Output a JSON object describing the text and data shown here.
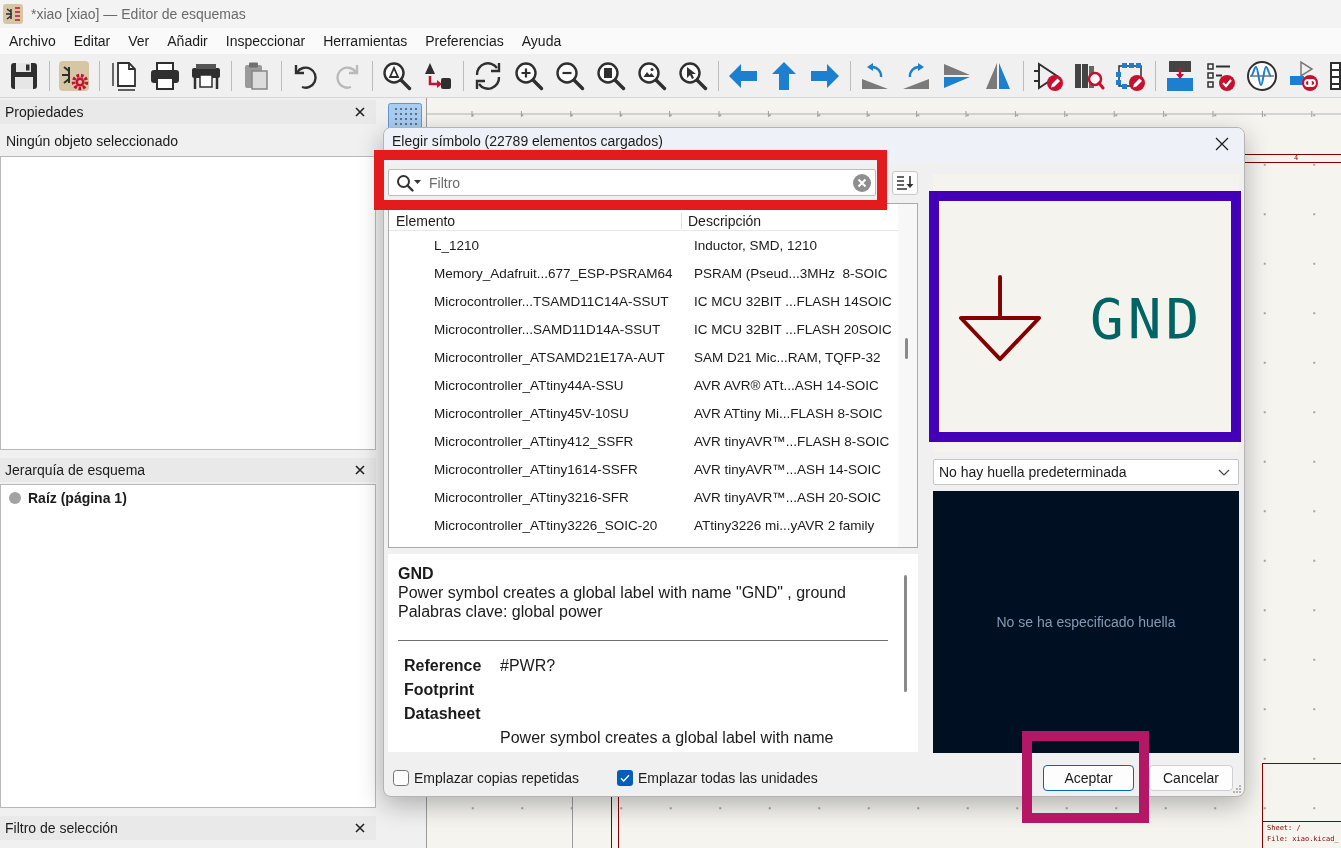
{
  "window": {
    "title": "*xiao [xiao] — Editor de esquemas"
  },
  "menu": [
    "Archivo",
    "Editar",
    "Ver",
    "Añadir",
    "Inspeccionar",
    "Herramientas",
    "Preferencias",
    "Ayuda"
  ],
  "toolbar": {
    "groups": [
      [
        {
          "kind": "save",
          "disabled": false
        }
      ],
      [
        {
          "kind": "schematic-setup",
          "disabled": false
        }
      ],
      [
        {
          "kind": "page-settings",
          "disabled": false
        },
        {
          "kind": "print",
          "disabled": false
        },
        {
          "kind": "plot",
          "disabled": false
        }
      ],
      [
        {
          "kind": "paste",
          "disabled": false
        }
      ],
      [
        {
          "kind": "undo",
          "disabled": false
        },
        {
          "kind": "redo",
          "disabled": true
        }
      ],
      [
        {
          "kind": "find",
          "disabled": false
        },
        {
          "kind": "find-replace",
          "disabled": false
        }
      ],
      [
        {
          "kind": "refresh",
          "disabled": false
        },
        {
          "kind": "zoom-in",
          "disabled": false
        },
        {
          "kind": "zoom-out",
          "disabled": false
        },
        {
          "kind": "zoom-fit",
          "disabled": false
        },
        {
          "kind": "zoom-objects",
          "disabled": false
        },
        {
          "kind": "zoom-selection",
          "disabled": false
        }
      ],
      [
        {
          "kind": "pan-left",
          "disabled": false
        },
        {
          "kind": "pan-up",
          "disabled": false
        },
        {
          "kind": "pan-right",
          "disabled": false
        }
      ],
      [
        {
          "kind": "rotate-ccw",
          "disabled": false
        },
        {
          "kind": "rotate-cw",
          "disabled": false
        },
        {
          "kind": "mirror-v",
          "disabled": false
        },
        {
          "kind": "mirror-h",
          "disabled": false
        }
      ],
      [
        {
          "kind": "symbol-fields",
          "disabled": false
        },
        {
          "kind": "library-browser",
          "disabled": false
        },
        {
          "kind": "edit-symbol",
          "disabled": false
        }
      ],
      [
        {
          "kind": "annotate",
          "disabled": false
        },
        {
          "kind": "erc",
          "disabled": false
        },
        {
          "kind": "simulator",
          "disabled": false
        },
        {
          "kind": "assign-footprints",
          "disabled": false
        },
        {
          "kind": "table",
          "disabled": false
        }
      ]
    ]
  },
  "properties_panel": {
    "title": "Propiedades",
    "message": "Ningún objeto seleccionado"
  },
  "hierarchy_panel": {
    "title": "Jerarquía de esquema",
    "items": [
      {
        "label": "Raíz (página 1)",
        "current": true
      }
    ]
  },
  "selection_filter_panel": {
    "title": "Filtro de selección"
  },
  "canvas": {
    "toolbar": [
      {
        "kind": "grid",
        "on": true
      }
    ],
    "frame_column_label": "4",
    "title_block": {
      "sheet": "Sheet: /",
      "file": "File: xiao.kicad_"
    }
  },
  "dialog": {
    "title": "Elegir símbolo (22789 elementos cargados)",
    "search": {
      "placeholder": "Filtro"
    },
    "columns": [
      "Elemento",
      "Descripción"
    ],
    "rows": [
      {
        "name": "L_1210",
        "description": "Inductor, SMD, 1210",
        "selected": false
      },
      {
        "name": "Memory_Adafruit...677_ESP-PSRAM64",
        "description": "PSRAM (Pseud...3MHz  8-SOIC",
        "selected": false
      },
      {
        "name": "Microcontroller...TSAMD11C14A-SSUT",
        "description": "IC MCU 32BIT ...FLASH 14SOIC",
        "selected": false
      },
      {
        "name": "Microcontroller...SAMD11D14A-SSUT",
        "description": "IC MCU 32BIT ...FLASH 20SOIC",
        "selected": false
      },
      {
        "name": "Microcontroller_ATSAMD21E17A-AUT",
        "description": "SAM D21 Mic...RAM, TQFP-32",
        "selected": false
      },
      {
        "name": "Microcontroller_ATtiny44A-SSU",
        "description": "AVR AVR® ATt...ASH 14-SOIC",
        "selected": false
      },
      {
        "name": "Microcontroller_ATtiny45V-10SU",
        "description": "AVR ATtiny Mi...FLASH 8-SOIC",
        "selected": false
      },
      {
        "name": "Microcontroller_ATtiny412_SSFR",
        "description": "AVR tinyAVR™...FLASH 8-SOIC",
        "selected": false
      },
      {
        "name": "Microcontroller_ATtiny1614-SSFR",
        "description": "AVR tinyAVR™...ASH 14-SOIC",
        "selected": false
      },
      {
        "name": "Microcontroller_ATtiny3216-SFR",
        "description": "AVR tinyAVR™...ASH 20-SOIC",
        "selected": false
      },
      {
        "name": "Microcontroller_ATtiny3226_SOIC-20",
        "description": "ATtiny3226 mi...yAVR 2 family",
        "selected": false
      }
    ],
    "details": {
      "name": "GND",
      "description": "Power symbol creates a global label with name \"GND\" , ground",
      "keywords": "Palabras clave: global power",
      "fields": [
        {
          "name": "Reference",
          "value": "#PWR?"
        },
        {
          "name": "Footprint"
        },
        {
          "name": "Datasheet"
        },
        {
          "value": "Power symbol creates a global label with name"
        }
      ]
    },
    "preview": {
      "symbol_value": "GND"
    },
    "footprint_select": {
      "value": "No hay huella predeterminada"
    },
    "footprint_preview": {
      "message": "No se ha especificado huella"
    },
    "options": [
      {
        "label": "Emplazar copias repetidas",
        "checked": false
      },
      {
        "label": "Emplazar todas las unidades",
        "checked": true
      }
    ],
    "buttons": [
      {
        "label": "Aceptar",
        "default": true
      },
      {
        "label": "Cancelar",
        "default": false
      }
    ]
  },
  "annotation_frames": [
    {
      "color": "#e41b1d"
    },
    {
      "color": "#4300b8"
    },
    {
      "color": "#b31766"
    }
  ]
}
